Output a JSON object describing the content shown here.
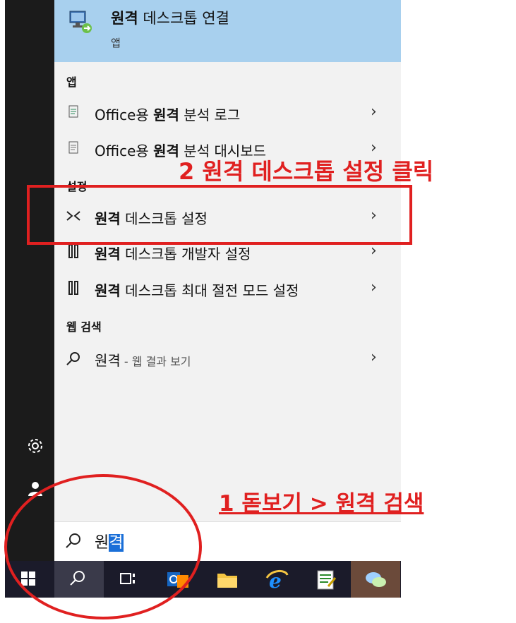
{
  "top_result": {
    "title_bold": "원격",
    "title_rest": " 데스크톱 연결",
    "subtitle": "앱"
  },
  "sections": {
    "apps": "앱",
    "settings": "설정",
    "web": "웹 검색"
  },
  "app_items": [
    {
      "pre": "Office용 ",
      "bold": "원격",
      "post": " 분석 로그"
    },
    {
      "pre": "Office용 ",
      "bold": "원격",
      "post": " 분석 대시보드"
    }
  ],
  "settings_items": [
    {
      "bold": "원격",
      "post": " 데스크톱 설정"
    },
    {
      "bold": "원격",
      "post": " 데스크톱 개발자 설정"
    },
    {
      "bold": "원격",
      "post": " 데스크톱 최대 절전 모드 설정"
    }
  ],
  "web_item": {
    "label": "원격",
    "sub": " - 웹 결과 보기"
  },
  "search": {
    "typed": "원",
    "selected": "격"
  },
  "annotations": {
    "step2": "2 원격 데스크톱 설정 클릭",
    "step1": "1 돋보기 > 원격 검색"
  },
  "colors": {
    "accent_highlight": "#a8d0ee",
    "annotation_red": "#e02020",
    "rail_bg": "#1b1b1b",
    "selection_blue": "#1a6fd8"
  },
  "icons": {
    "chevron": "›",
    "settings_rail": "gear-icon",
    "user_rail": "user-icon"
  }
}
